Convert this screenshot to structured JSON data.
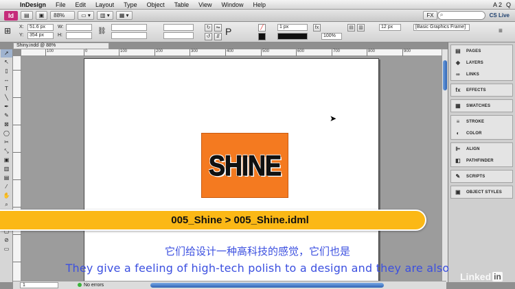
{
  "menubar": {
    "apple": "",
    "items": [
      "InDesign",
      "File",
      "Edit",
      "Layout",
      "Type",
      "Object",
      "Table",
      "View",
      "Window",
      "Help"
    ],
    "right": [
      "A 2",
      "Q"
    ]
  },
  "appbar": {
    "logo": "Id",
    "zoom": "88%",
    "workspace": "FX",
    "search_placeholder": "",
    "cs_live": "CS Live"
  },
  "control": {
    "x_label": "X:",
    "x_value": "51.6 px",
    "y_label": "Y:",
    "y_value": "354 px",
    "w_label": "W:",
    "h_label": "H:",
    "stroke_weight": "1 px",
    "opacity": "100%",
    "gap": "12 px",
    "object_style": "[Basic Graphics Frame]"
  },
  "document": {
    "tab_title": "Shiny.indd @ 88%",
    "ruler_ticks": [
      "100",
      "0",
      "100",
      "200",
      "300",
      "400",
      "500",
      "600",
      "700",
      "800",
      "900"
    ],
    "frame_text": "SHINE"
  },
  "panels": {
    "groups": [
      [
        {
          "icon": "pages-icon",
          "glyph": "▤",
          "label": "PAGES"
        },
        {
          "icon": "layers-icon",
          "glyph": "◈",
          "label": "LAYERS"
        },
        {
          "icon": "links-icon",
          "glyph": "∞",
          "label": "LINKS"
        }
      ],
      [
        {
          "icon": "effects-icon",
          "glyph": "fx",
          "label": "EFFECTS"
        }
      ],
      [
        {
          "icon": "swatches-icon",
          "glyph": "▦",
          "label": "SWATCHES"
        }
      ],
      [
        {
          "icon": "stroke-icon",
          "glyph": "≡",
          "label": "STROKE"
        },
        {
          "icon": "color-icon",
          "glyph": "◐",
          "label": "COLOR"
        }
      ],
      [
        {
          "icon": "align-icon",
          "glyph": "⊫",
          "label": "ALIGN"
        },
        {
          "icon": "pathfinder-icon",
          "glyph": "◧",
          "label": "PATHFINDER"
        }
      ],
      [
        {
          "icon": "scripts-icon",
          "glyph": "✎",
          "label": "SCRIPTS"
        }
      ],
      [
        {
          "icon": "object-styles-icon",
          "glyph": "▣",
          "label": "OBJECT STYLES"
        }
      ]
    ]
  },
  "status": {
    "page": "1",
    "errors": "No errors"
  },
  "overlay": {
    "banner": "005_Shine > 005_Shine.idml",
    "subtitle_cn": "它们给设计一种高科技的感觉，它们也是",
    "subtitle_en": "They give a feeling of high-tech  polish to a design and they are also",
    "brand": "Linked",
    "brand_box": "in"
  }
}
